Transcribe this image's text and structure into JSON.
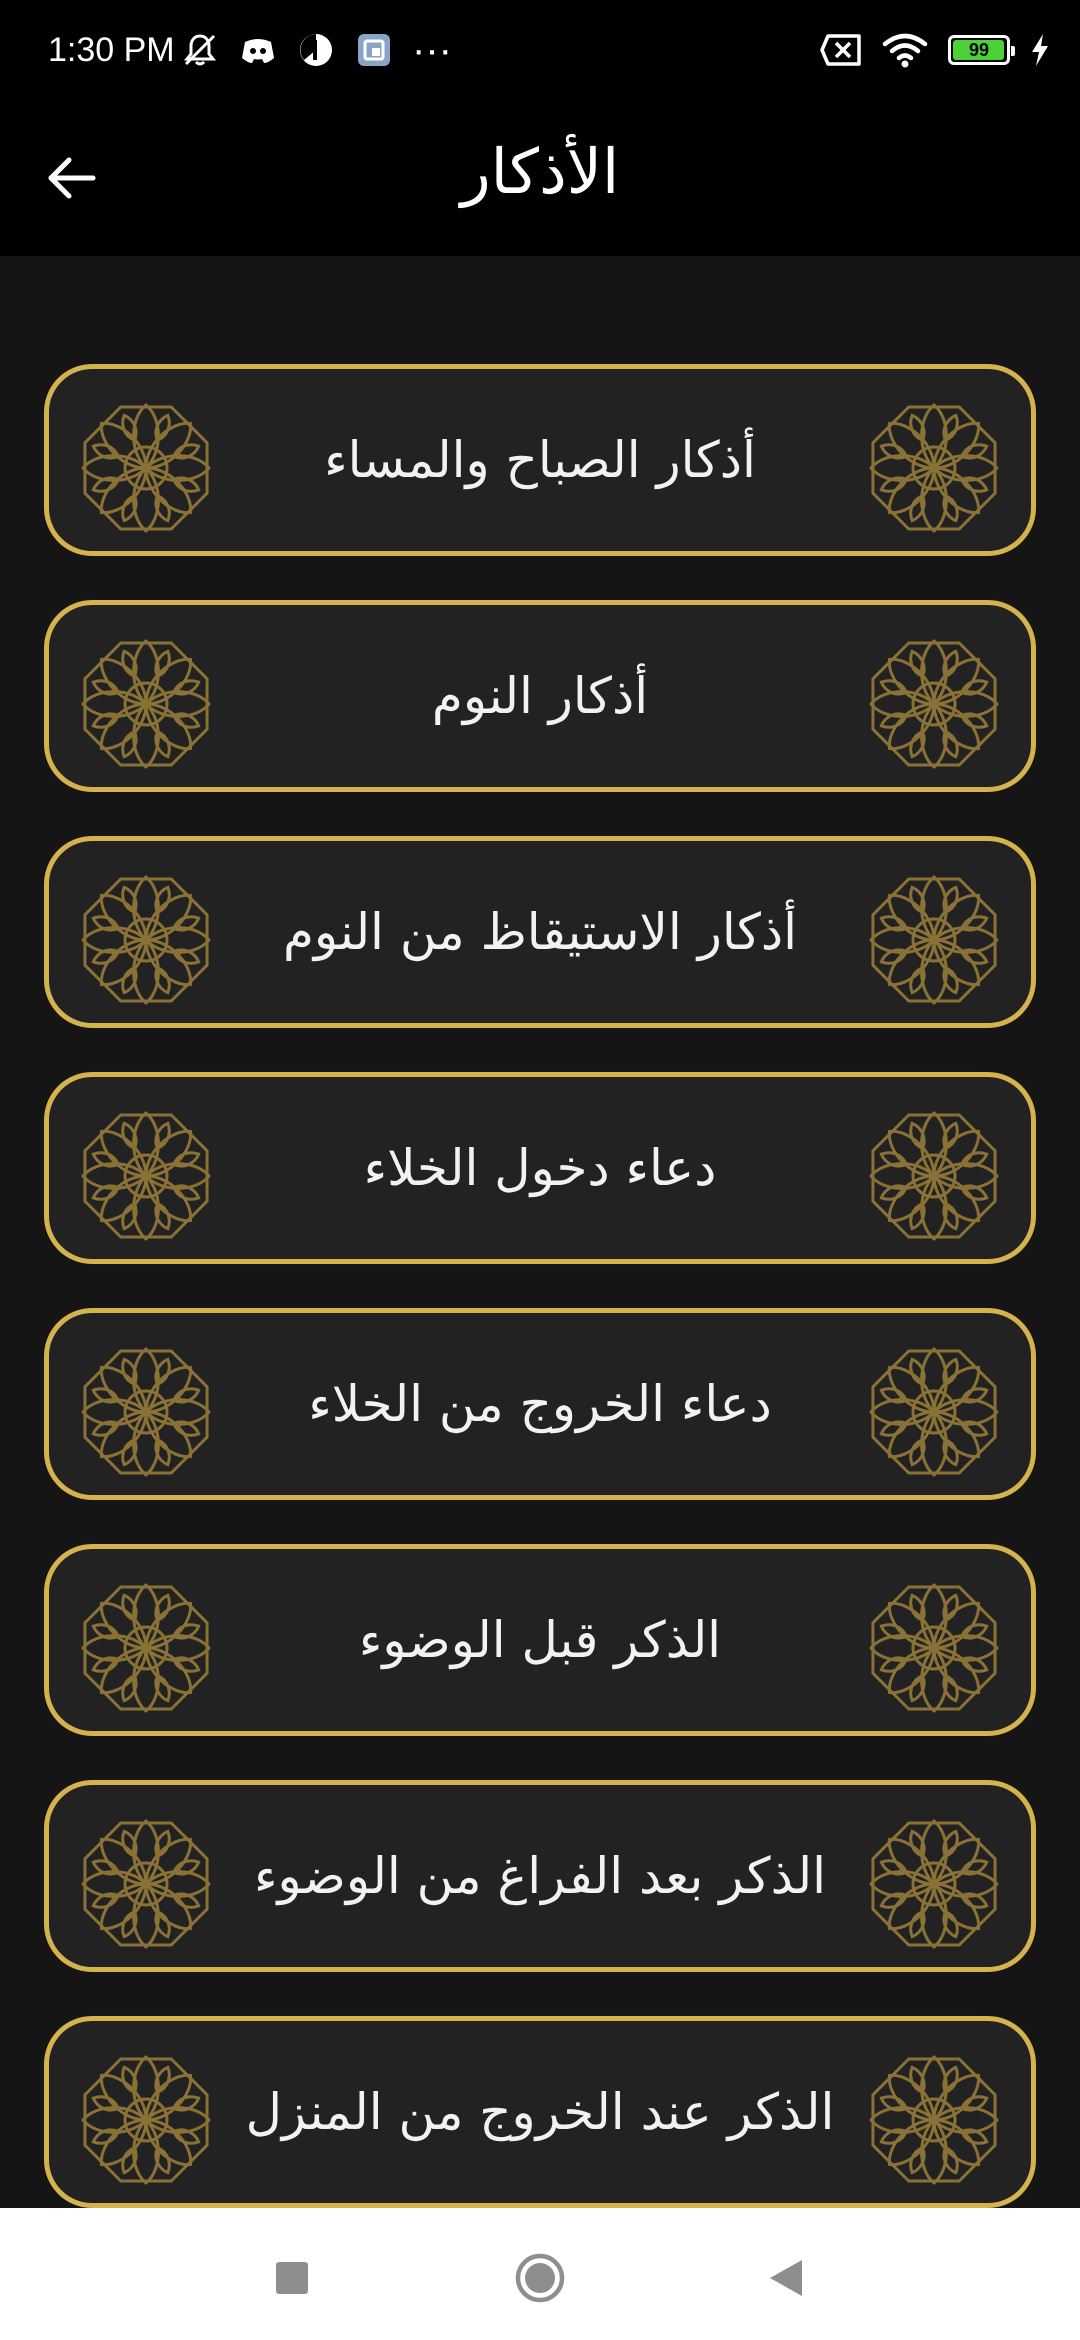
{
  "status_bar": {
    "time": "1:30 PM",
    "battery_level": "99",
    "battery_fraction": 0.99,
    "more_glyph": "···",
    "icons_left": [
      "mute-icon",
      "discord-icon",
      "pie-icon",
      "screenshot-icon",
      "more-icon"
    ],
    "icons_right": [
      "no-sim-icon",
      "wifi-icon",
      "battery-icon",
      "charging-icon"
    ]
  },
  "app_bar": {
    "title": "الأذكار",
    "back_icon": "arrow-left-icon"
  },
  "items": [
    {
      "label": "أذكار الصباح والمساء"
    },
    {
      "label": "أذكار النوم"
    },
    {
      "label": "أذكار الاستيقاظ من النوم"
    },
    {
      "label": "دعاء دخول الخلاء"
    },
    {
      "label": "دعاء الخروج من الخلاء"
    },
    {
      "label": "الذكر قبل الوضوء"
    },
    {
      "label": "الذكر بعد الفراغ من الوضوء"
    },
    {
      "label": "الذكر عند الخروج من المنزل"
    }
  ],
  "colors": {
    "accent_gold": "#d4b24c",
    "ornament_gold": "#8a7237",
    "card_bg": "#222222",
    "screen_bg": "#151515",
    "bar_bg": "#000000"
  },
  "nav_bar": {
    "buttons": [
      "recents-square-icon",
      "home-circle-icon",
      "back-triangle-icon"
    ]
  }
}
